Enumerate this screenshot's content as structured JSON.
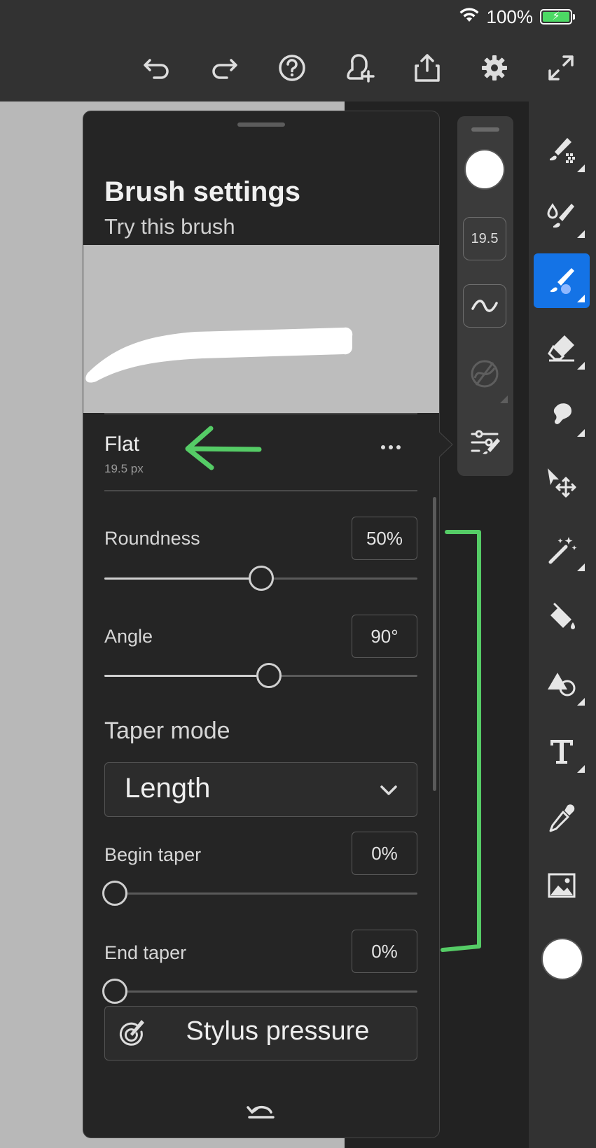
{
  "status_bar": {
    "battery_percent": "100%"
  },
  "toolbar": {
    "icons": [
      "undo-icon",
      "redo-icon",
      "help-icon",
      "invite-icon",
      "share-icon",
      "settings-icon",
      "fullscreen-icon"
    ]
  },
  "panel": {
    "title": "Brush settings",
    "subtitle": "Try this brush",
    "brush": {
      "name": "Flat",
      "size": "19.5 px"
    },
    "roundness": {
      "label": "Roundness",
      "value": "50%",
      "fraction": 0.5
    },
    "angle": {
      "label": "Angle",
      "value": "90°",
      "fraction": 0.525
    },
    "taper_mode": {
      "label": "Taper mode",
      "selected": "Length"
    },
    "begin_taper": {
      "label": "Begin taper",
      "value": "0%",
      "fraction": 0
    },
    "end_taper": {
      "label": "End taper",
      "value": "0%",
      "fraction": 0
    },
    "stylus": {
      "label": "Stylus pressure"
    }
  },
  "mini_panel": {
    "size_value": "19.5"
  },
  "colors": {
    "accent": "#1473e6",
    "annotation": "#55cc66",
    "panel_bg": "#252525",
    "canvas_gray": "#b8b8b8"
  }
}
